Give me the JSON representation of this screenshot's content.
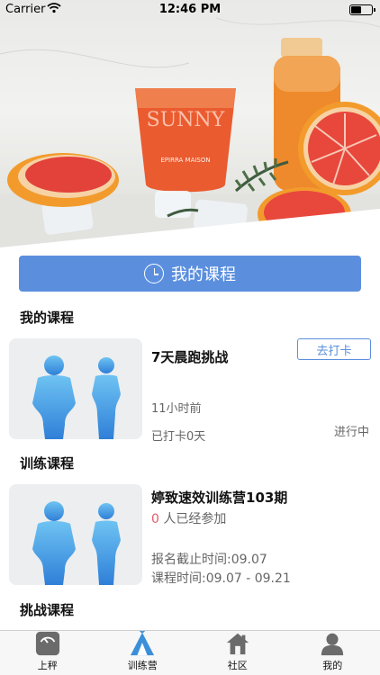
{
  "status_bar": {
    "carrier": "Carrier",
    "time": "12:46 PM",
    "battery_level": 0.45
  },
  "hero": {
    "glass_text": "SUNNY",
    "glass_subtext": "EPIRRA MAISON"
  },
  "my_course_button": {
    "label": "我的课程",
    "icon": "clock-icon"
  },
  "sections": {
    "my_courses": "我的课程",
    "training_courses": "训练课程",
    "challenge_courses": "挑战课程"
  },
  "my_course_card": {
    "title": "7天晨跑挑战",
    "checkin_label": "去打卡",
    "time_ago": "11小时前",
    "checked_in": "已打卡0天",
    "status": "进行中"
  },
  "training_card": {
    "title": "婷致速效训练营103期",
    "participants": "0",
    "participants_suffix": "人已经参加",
    "deadline": "报名截止时间:09.07",
    "course_time": "课程时间:09.07 - 09.21"
  },
  "tab_bar": {
    "items": [
      {
        "label": "上秤",
        "icon": "scale-icon"
      },
      {
        "label": "训练营",
        "icon": "tent-icon",
        "active": true
      },
      {
        "label": "社区",
        "icon": "house-icon"
      },
      {
        "label": "我的",
        "icon": "person-icon"
      }
    ]
  },
  "colors": {
    "accent": "#5b8fde",
    "highlight": "#e85a6a",
    "active_tab": "#3b8fd8"
  }
}
